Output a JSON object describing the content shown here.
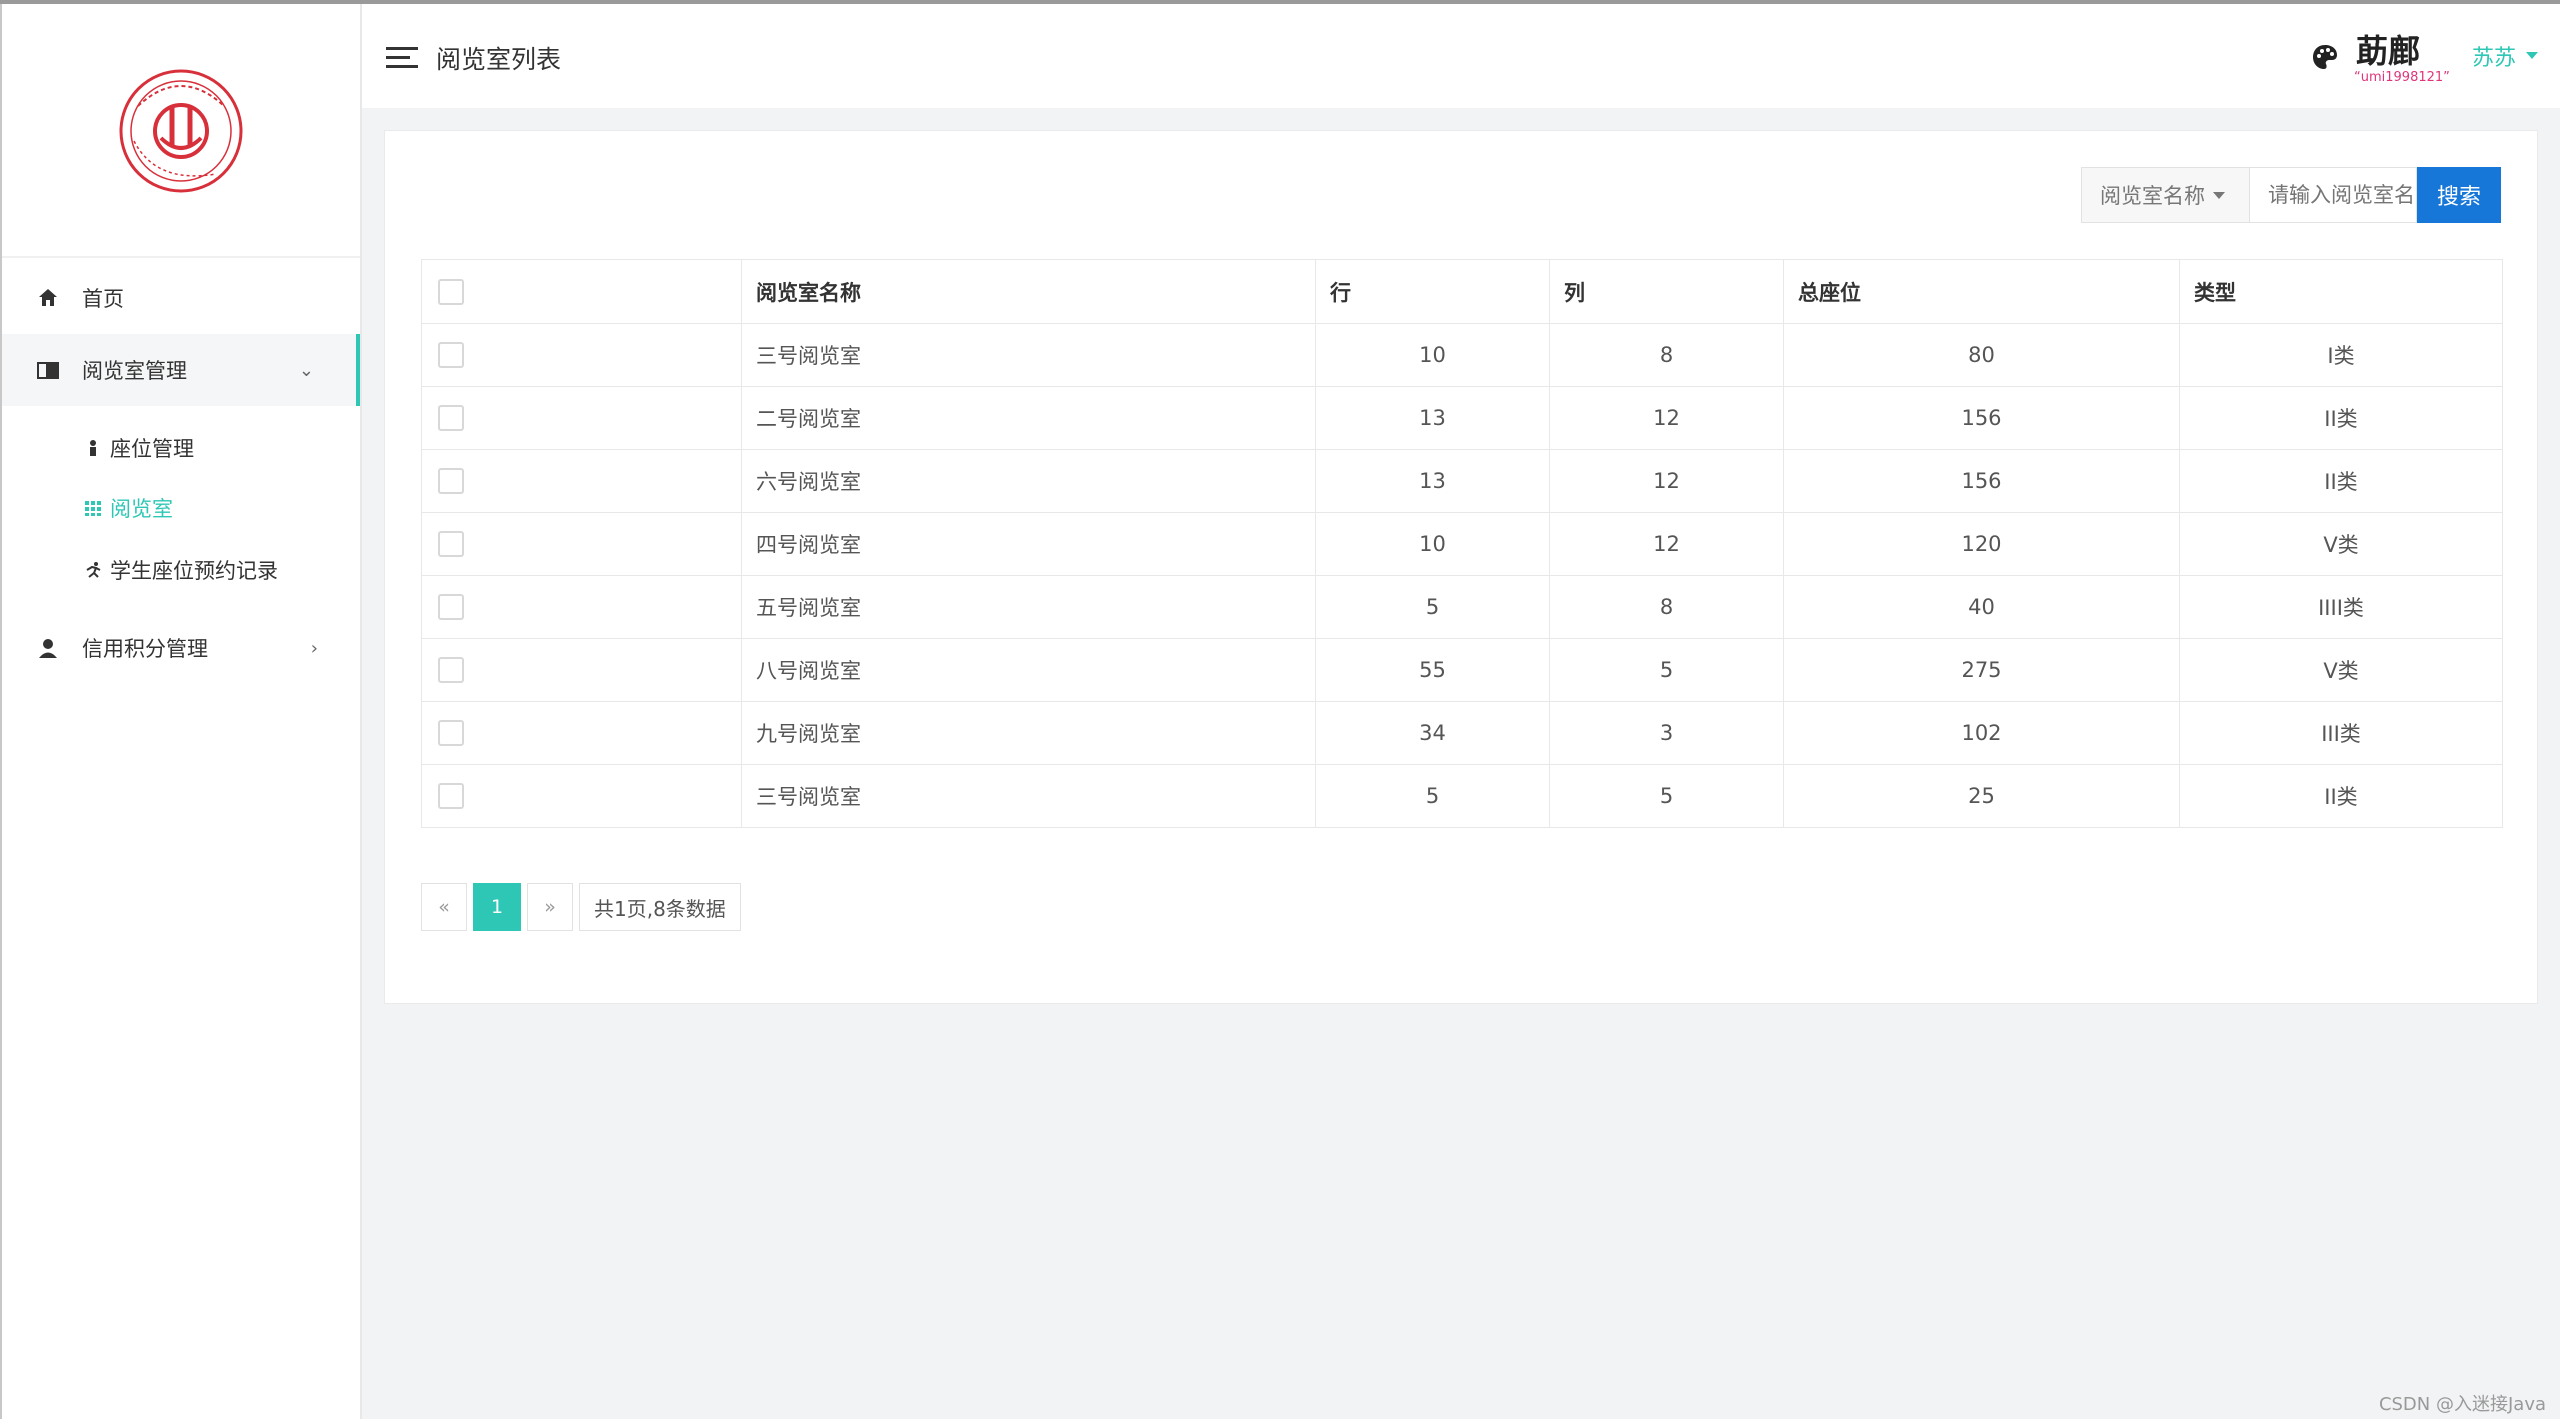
{
  "sidebar": {
    "items": [
      {
        "label": "首页",
        "icon": "home-icon"
      },
      {
        "label": "阅览室管理",
        "icon": "book-icon",
        "chevron": "⌄"
      },
      {
        "label": "信用积分管理",
        "icon": "user-icon",
        "chevron": "›"
      }
    ],
    "subitems": [
      {
        "label": "座位管理",
        "icon": "person-icon"
      },
      {
        "label": "阅览室",
        "icon": "grid-icon"
      },
      {
        "label": "学生座位预约记录",
        "icon": "running-icon"
      }
    ]
  },
  "header": {
    "title": "阅览室列表",
    "avatar_text": "莇鄜",
    "avatar_sub": "“umi1998121”",
    "user_name": "苏苏"
  },
  "search": {
    "field_label": "阅览室名称",
    "placeholder": "请输入阅览室名",
    "button": "搜索"
  },
  "table": {
    "columns": [
      "阅览室名称",
      "行",
      "列",
      "总座位",
      "类型"
    ],
    "rows": [
      {
        "name": "三号阅览室",
        "row": "10",
        "col": "8",
        "total": "80",
        "type": "I类"
      },
      {
        "name": "二号阅览室",
        "row": "13",
        "col": "12",
        "total": "156",
        "type": "II类"
      },
      {
        "name": "六号阅览室",
        "row": "13",
        "col": "12",
        "total": "156",
        "type": "II类"
      },
      {
        "name": "四号阅览室",
        "row": "10",
        "col": "12",
        "total": "120",
        "type": "V类"
      },
      {
        "name": "五号阅览室",
        "row": "5",
        "col": "8",
        "total": "40",
        "type": "IIII类"
      },
      {
        "name": "八号阅览室",
        "row": "55",
        "col": "5",
        "total": "275",
        "type": "V类"
      },
      {
        "name": "九号阅览室",
        "row": "34",
        "col": "3",
        "total": "102",
        "type": "III类"
      },
      {
        "name": "三号阅览室",
        "row": "5",
        "col": "5",
        "total": "25",
        "type": "II类"
      }
    ]
  },
  "pagination": {
    "prev": "«",
    "current": "1",
    "next": "»",
    "info": "共1页,8条数据"
  },
  "watermark": "CSDN @入迷接Java",
  "colors": {
    "accent": "#2ec7b5",
    "primary_button": "#1777d8",
    "logo_red": "#d8303a"
  }
}
